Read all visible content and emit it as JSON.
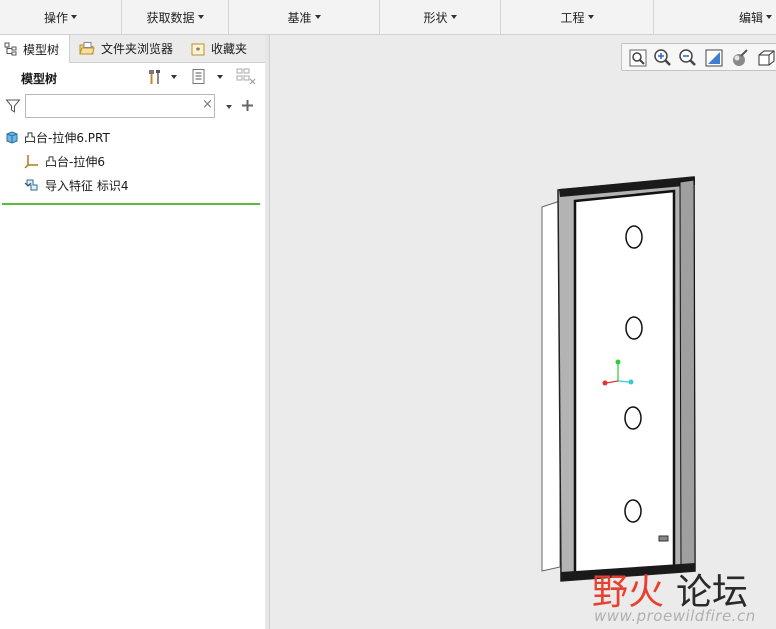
{
  "ribbon": {
    "groups": [
      {
        "label": "操作"
      },
      {
        "label": "获取数据"
      },
      {
        "label": "基准"
      },
      {
        "label": "形状"
      },
      {
        "label": "工程"
      },
      {
        "label": "编辑"
      }
    ]
  },
  "panel": {
    "tabs": [
      {
        "label": "模型树",
        "active": true
      },
      {
        "label": "文件夹浏览器",
        "active": false
      },
      {
        "label": "收藏夹",
        "active": false
      }
    ],
    "tree_label": "模型树",
    "search": {
      "value": "",
      "placeholder": ""
    },
    "tree": [
      {
        "label": "凸台-拉伸6.PRT",
        "icon": "part-icon"
      },
      {
        "label": "凸台-拉伸6",
        "icon": "csys-icon"
      },
      {
        "label": "导入特征 标识4",
        "icon": "import-feature-icon"
      }
    ]
  },
  "viewbar": {
    "buttons": [
      "refit-icon",
      "zoom-in-icon",
      "zoom-out-icon",
      "repaint-icon",
      "display-style-icon",
      "saved-views-icon"
    ]
  },
  "watermark": {
    "cn_part1": "野火",
    "cn_part2": "论坛",
    "url": "www.proewildfire.cn"
  },
  "colors": {
    "insert_line": "#5cba3c",
    "watermark_red": "#e8402e",
    "watermark_gray": "#2a2a2a",
    "axis_x": "#e53030",
    "axis_y": "#2bcf3a",
    "axis_z": "#35c9d9"
  }
}
